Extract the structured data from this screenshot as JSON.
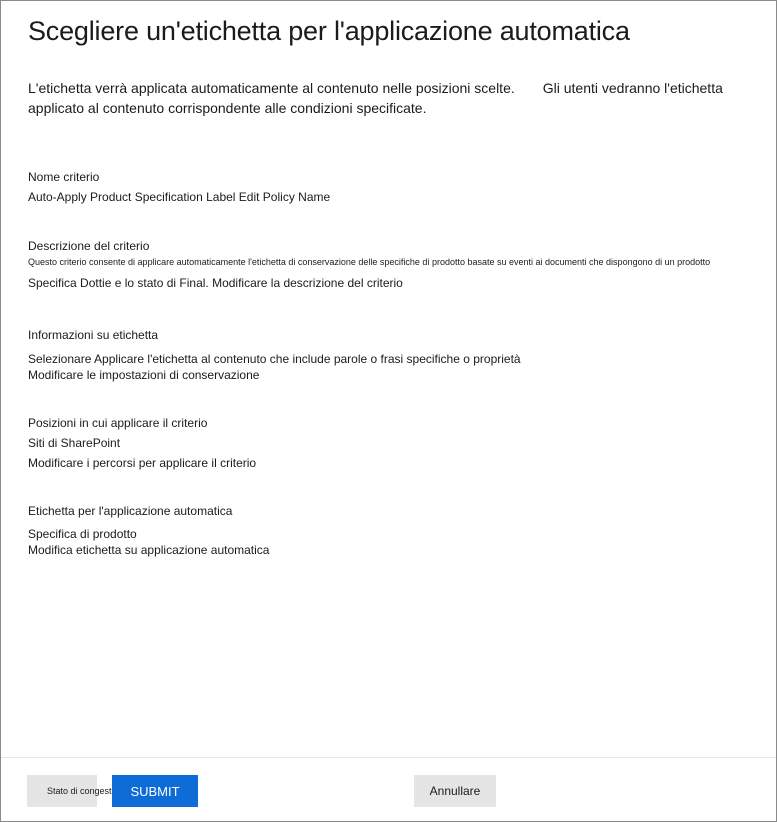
{
  "dialog": {
    "title": "Scegliere un'etichetta per l'applicazione automatica",
    "intro_part1": "L'etichetta verrà applicata automaticamente al contenuto nelle posizioni scelte.",
    "intro_part2": "Gli utenti vedranno l'etichetta applicato al contenuto corrispondente alle condizioni specificate."
  },
  "sections": {
    "policy_name": {
      "label": "Nome criterio",
      "value": "Auto-Apply Product Specification Label Edit Policy Name"
    },
    "policy_description": {
      "label": "Descrizione del criterio",
      "value_line1": "Questo criterio consente di applicare automaticamente l'etichetta di conservazione delle specifiche di prodotto basate su eventi ai documenti che dispongono di un prodotto",
      "value_line2": "Specifica Dottie e lo stato di Final. Modificare la descrizione del criterio"
    },
    "label_info": {
      "label": "Informazioni su etichetta",
      "value": "Selezionare Applicare l'etichetta al contenuto che include parole o frasi specifiche o proprietà",
      "link": "Modificare le impostazioni di conservazione"
    },
    "locations": {
      "label": "Posizioni in cui applicare il criterio",
      "value": "Siti di SharePoint",
      "link": "Modificare i percorsi per applicare il criterio"
    },
    "auto_label": {
      "label": "Etichetta per l'applicazione automatica",
      "value": "Specifica di prodotto",
      "link": "Modifica etichetta su applicazione automatica"
    }
  },
  "footer": {
    "congestion_label": "Stato di congestione",
    "submit_label": "SUBMIT",
    "cancel_label": "Annullare",
    "submit_color": "#0f6cd6"
  }
}
